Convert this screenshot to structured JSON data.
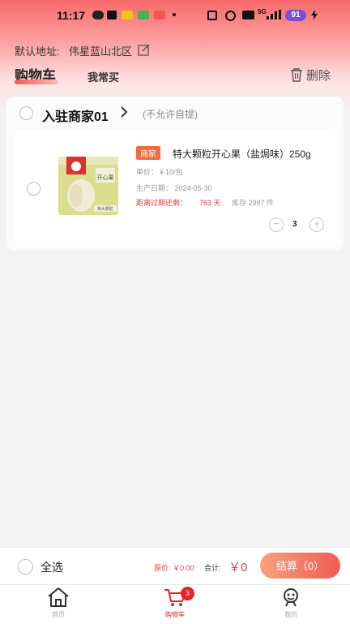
{
  "status_bar": {
    "time": "11:17",
    "network": "5G",
    "battery": "91"
  },
  "address": {
    "label": "默认地址:",
    "value": "伟星蓝山北区"
  },
  "tabs": {
    "cart": "购物车",
    "frequent": "我常买"
  },
  "delete_label": "删除",
  "shop": {
    "name": "入驻商家01",
    "note": "(不允许自提)"
  },
  "item": {
    "badge": "商家",
    "name": "特大颗粒开心果（盐焗味）250g",
    "unit_price": "单价：￥10/包",
    "production_date": "生产日期：  2024-05-30",
    "expiry_label": "距离过期还剩：",
    "expiry_value": "763 天",
    "stock": "库存 2987 件",
    "quantity": "3",
    "package_label": "开心果",
    "package_sub": "特大颗粒"
  },
  "footer": {
    "select_all": "全选",
    "original_price": "原价: ￥0.00",
    "total_label": "合计:",
    "total_value": "￥0",
    "checkout": "结算（0）"
  },
  "nav": {
    "home": "首页",
    "cart": "购物车",
    "mine": "我的",
    "cart_badge": "3"
  },
  "colors": {
    "accent": "#e43a3a",
    "brand_gradient_start": "#f86a6a",
    "checkout_start": "#f7a080",
    "checkout_end": "#ef5c52"
  }
}
